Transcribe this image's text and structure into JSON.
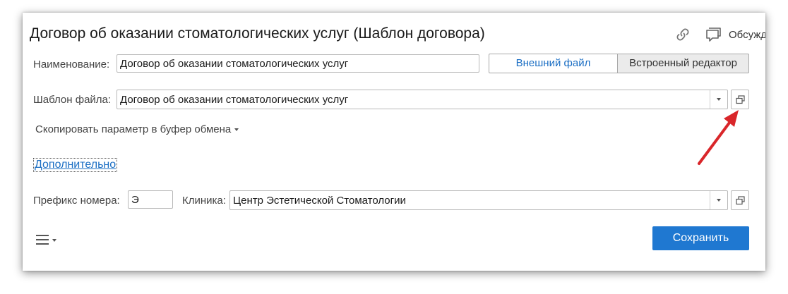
{
  "header": {
    "title": "Договор об оказании стоматологических услуг (Шаблон договора)",
    "discuss_label": "Обсужд"
  },
  "form": {
    "name_label": "Наименование:",
    "name_value": "Договор об оказании стоматологических услуг",
    "external_file_label": "Внешний файл",
    "builtin_editor_label": "Встроенный редактор",
    "template_label": "Шаблон файла:",
    "template_value": "Договор об оказании стоматологических услуг",
    "copy_param_label": "Скопировать параметр в буфер обмена",
    "additional_label": "Дополнительно",
    "prefix_label": "Префикс номера:",
    "prefix_value": "Э",
    "clinic_label": "Клиника:",
    "clinic_value": "Центр Эстетической Стоматологии"
  },
  "footer": {
    "save_label": "Сохранить"
  },
  "icons": {
    "link": "link-icon",
    "comment": "comment-icon",
    "open": "open-in-new-window-icon",
    "menu": "hamburger-menu-icon",
    "annotation": "red-arrow-annotation"
  },
  "colors": {
    "accent": "#1f78d1",
    "link": "#1c6fc4",
    "arrow": "#d9262a"
  }
}
